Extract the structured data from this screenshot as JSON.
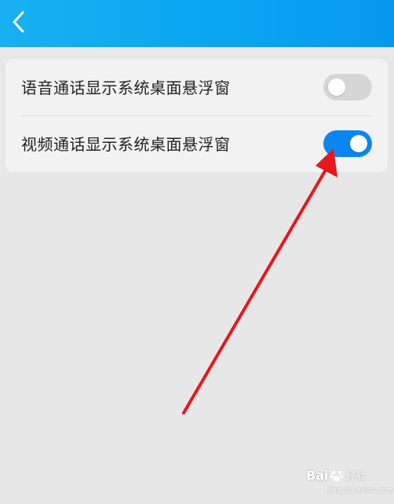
{
  "header": {
    "back_icon": "chevron-left-icon",
    "background_color": "#0aa6f3"
  },
  "settings": {
    "items": [
      {
        "label": "语音通话显示系统桌面悬浮窗",
        "toggle": "off"
      },
      {
        "label": "视频通话显示系统桌面悬浮窗",
        "toggle": "on"
      }
    ],
    "toggle_on_color": "#0b86f0",
    "toggle_off_color": "#d6d6d6"
  },
  "annotation": {
    "arrow_color": "#e8161e",
    "points_to": "video-call-floating-window-toggle"
  },
  "watermark": {
    "brand_text": "Bai",
    "brand_suffix": "经验",
    "url": "jingyan.baidu.com"
  }
}
